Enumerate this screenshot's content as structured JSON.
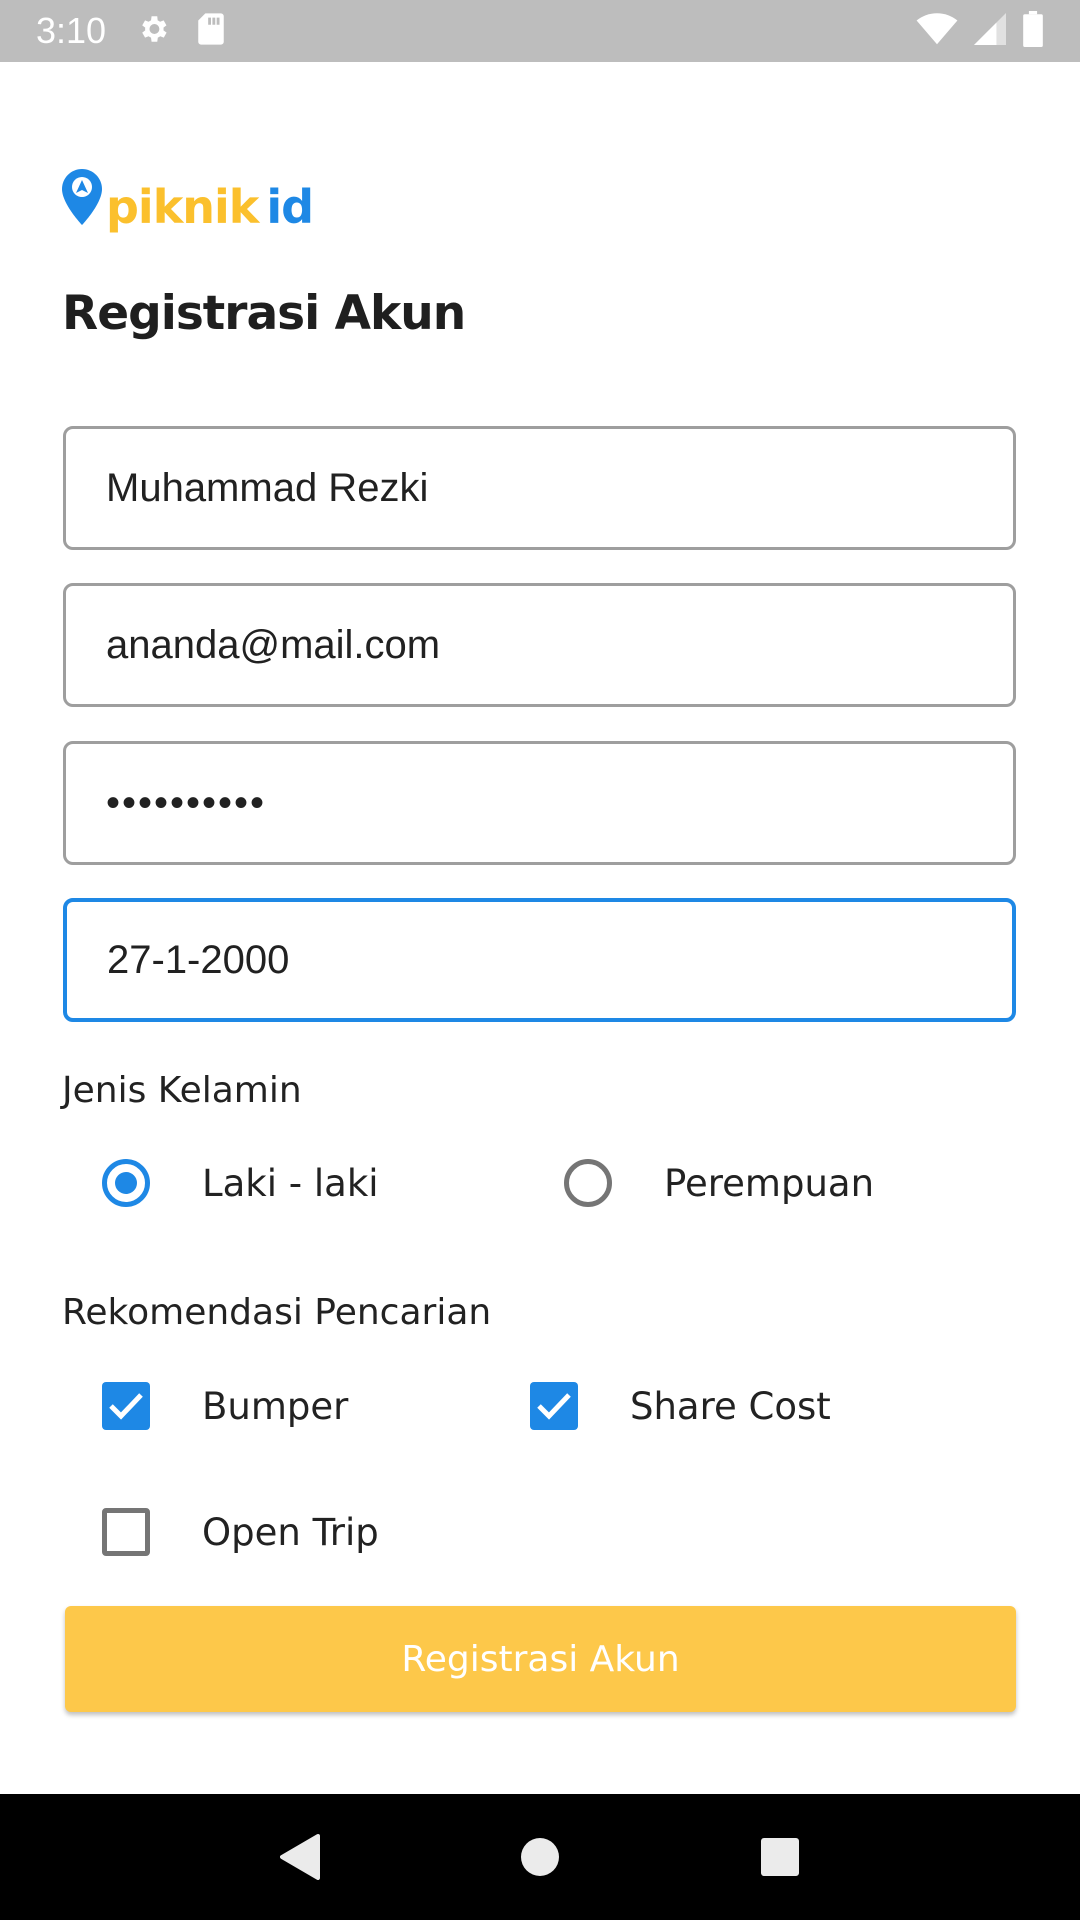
{
  "status_bar": {
    "time": "3:10",
    "left_icons": [
      "gear-icon",
      "sd-card-icon"
    ],
    "right_icons": [
      "wifi-icon",
      "cell-signal-icon",
      "battery-icon"
    ]
  },
  "logo": {
    "part1": "piknik",
    "part2": "id",
    "pin_icon": "location-pin-icon",
    "colors": {
      "yellow": "#fbc02d",
      "blue": "#1e88e5"
    }
  },
  "page": {
    "title": "Registrasi Akun"
  },
  "form": {
    "name_value": "Muhammad Rezki",
    "email_value": "ananda@mail.com",
    "password_value": "••••••••••",
    "birthdate_value": "27-1-2000"
  },
  "gender": {
    "label": "Jenis Kelamin",
    "options": [
      {
        "label": "Laki - laki",
        "selected": true
      },
      {
        "label": "Perempuan",
        "selected": false
      }
    ]
  },
  "recommendation": {
    "label": "Rekomendasi Pencarian",
    "options": [
      {
        "label": "Bumper",
        "checked": true
      },
      {
        "label": "Share Cost",
        "checked": true
      },
      {
        "label": "Open Trip",
        "checked": false
      }
    ]
  },
  "submit": {
    "label": "Registrasi Akun",
    "color": "#fdc84a"
  },
  "nav_bar": {
    "icons": [
      "back-icon",
      "home-icon",
      "recents-icon"
    ]
  }
}
